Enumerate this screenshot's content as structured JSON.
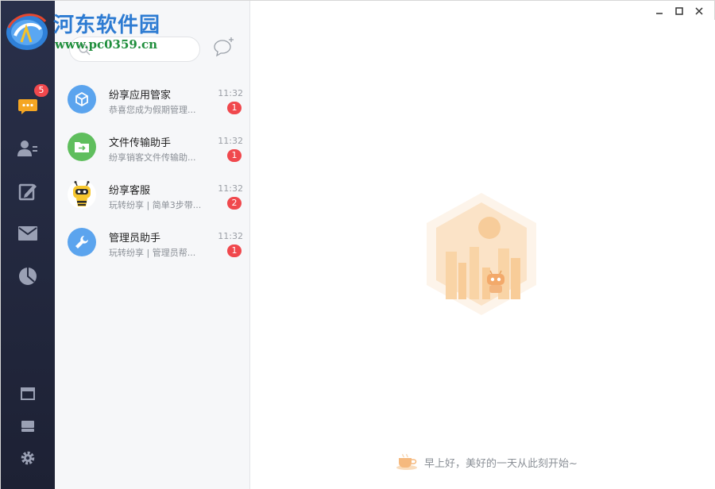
{
  "watermark": {
    "title": "河东软件园",
    "url": "www.pc0359.cn"
  },
  "nav": {
    "items": [
      {
        "id": "messages",
        "icon": "chat-bubble-icon",
        "badge": "5",
        "active": true
      },
      {
        "id": "contacts",
        "icon": "contacts-icon"
      },
      {
        "id": "notes",
        "icon": "edit-icon"
      },
      {
        "id": "mail",
        "icon": "mail-icon"
      },
      {
        "id": "stats",
        "icon": "pie-chart-icon"
      }
    ],
    "bottom": [
      {
        "id": "window",
        "icon": "window-icon"
      },
      {
        "id": "drive",
        "icon": "drive-icon"
      },
      {
        "id": "settings",
        "icon": "gear-icon"
      }
    ]
  },
  "sessions": [
    {
      "name": "纷享应用管家",
      "preview": "恭喜您成为假期管理...",
      "time": "11:32",
      "count": "1",
      "avatar_color": "#5ba4ee",
      "icon": "cube-icon"
    },
    {
      "name": "文件传输助手",
      "preview": "纷享销客文件传输助...",
      "time": "11:32",
      "count": "1",
      "avatar_color": "#5fbe5d",
      "icon": "folder-transfer-icon"
    },
    {
      "name": "纷享客服",
      "preview": "玩转纷享 | 简单3步带...",
      "time": "11:32",
      "count": "2",
      "avatar_color": "#ffffff",
      "icon": "bee-mascot-icon"
    },
    {
      "name": "管理员助手",
      "preview": "玩转纷享 | 管理员帮...",
      "time": "11:32",
      "count": "1",
      "avatar_color": "#5ba4ee",
      "icon": "wrench-icon"
    }
  ],
  "main": {
    "greeting": "早上好，美好的一天从此刻开始~"
  },
  "colors": {
    "nav_bg": "#242a40",
    "badge": "#f0484d",
    "accent_orange": "#f5a623"
  }
}
